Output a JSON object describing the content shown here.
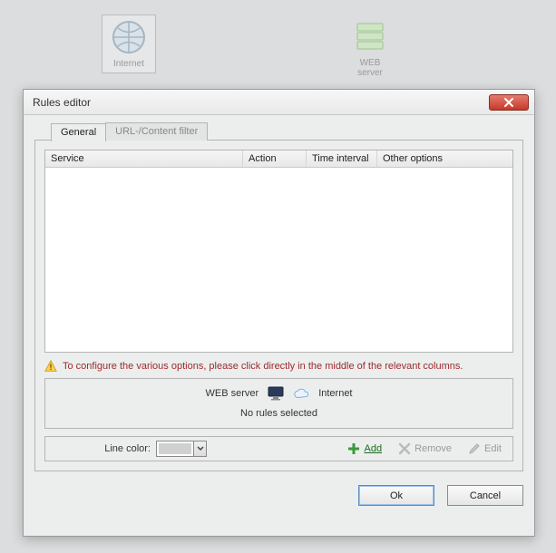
{
  "desktop": {
    "internet_label": "Internet",
    "web_label": "WEB server"
  },
  "dialog": {
    "title": "Rules editor",
    "tabs": {
      "general": "General",
      "url_filter": "URL-/Content filter"
    },
    "columns": {
      "service": "Service",
      "action": "Action",
      "time": "Time interval",
      "other": "Other options"
    },
    "warning_text": "To configure the various options, please click directly in the middle of the relevant columns.",
    "endpoint_left": "WEB server",
    "endpoint_right": "Internet",
    "no_rules": "No rules selected",
    "toolbar": {
      "line_color_label": "Line color:",
      "add": "Add",
      "remove": "Remove",
      "edit": "Edit"
    },
    "ok": "Ok",
    "cancel": "Cancel"
  }
}
